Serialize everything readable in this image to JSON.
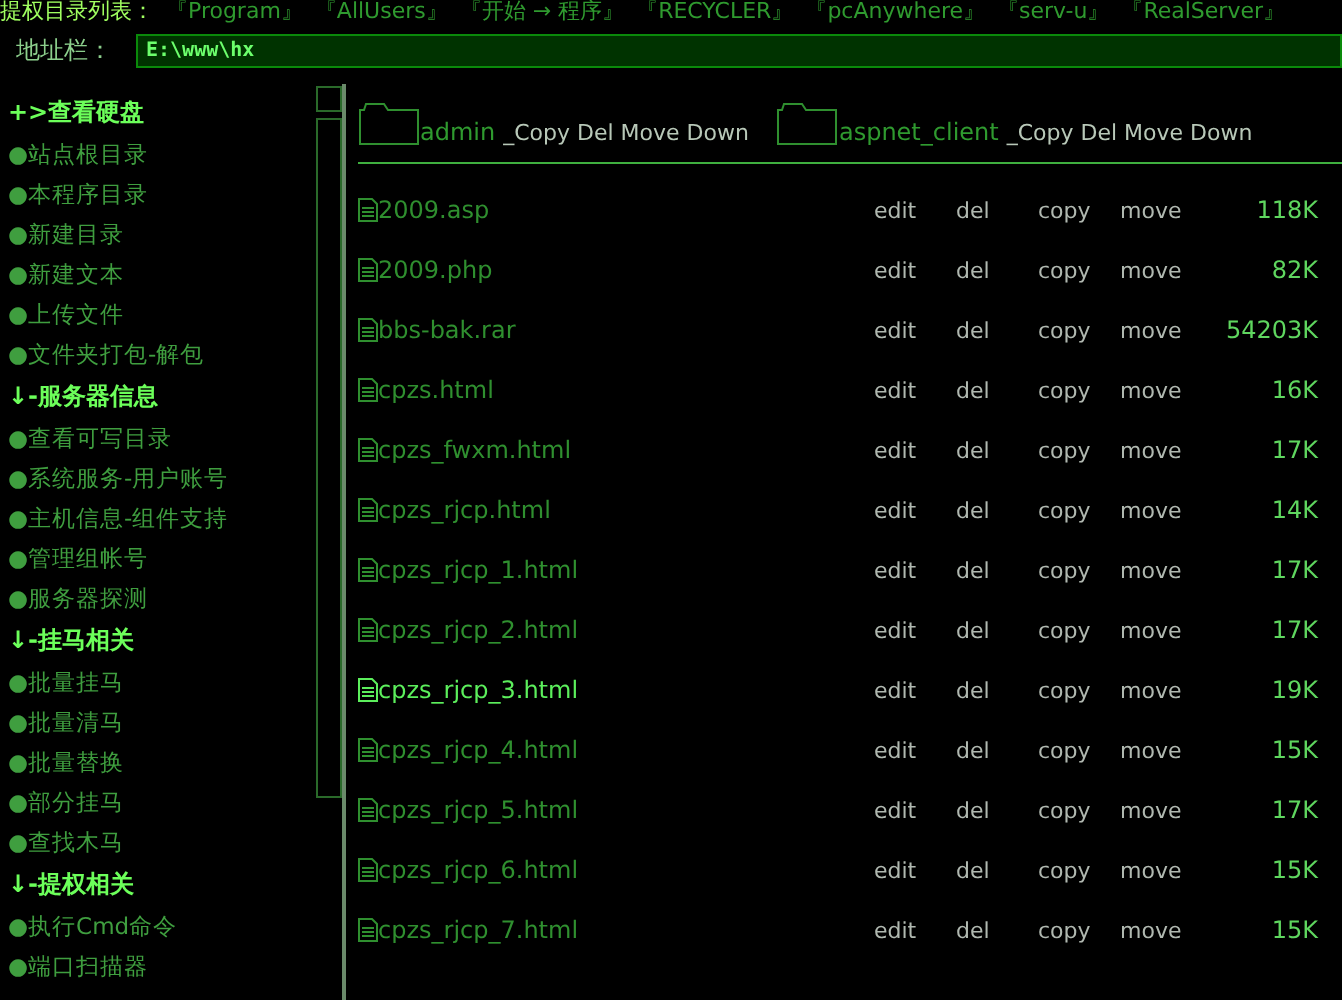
{
  "top_bar": {
    "label": "提权目录列表：",
    "links": [
      "『Program』",
      "『AllUsers』",
      "『开始 → 程序』",
      "『RECYCLER』",
      "『pcAnywhere』",
      "『serv-u』",
      "『RealServer』"
    ]
  },
  "address_bar": {
    "label": "地址栏：",
    "value": "E:\\www\\hx"
  },
  "sidebar": {
    "groups": [
      {
        "title": "+>查看硬盘",
        "items": [
          "●站点根目录",
          "●本程序目录",
          "●新建目录",
          "●新建文本",
          "●上传文件",
          "●文件夹打包-解包"
        ]
      },
      {
        "title": "↓-服务器信息",
        "items": [
          "●查看可写目录",
          "●系统服务-用户账号",
          "●主机信息-组件支持",
          "●管理组帐号",
          "●服务器探测"
        ]
      },
      {
        "title": "↓-挂马相关",
        "items": [
          "●批量挂马",
          "●批量清马",
          "●批量替换",
          "●部分挂马",
          "●查找木马"
        ]
      },
      {
        "title": "↓-提权相关",
        "items": [
          "●执行Cmd命令",
          "●端口扫描器"
        ]
      }
    ]
  },
  "folders": [
    {
      "name": "admin",
      "actions": "_Copy Del Move Down"
    },
    {
      "name": "aspnet_client",
      "actions": "_Copy Del Move Down"
    }
  ],
  "files": [
    {
      "name": "2009.asp",
      "actions": [
        "edit",
        "del",
        "copy",
        "move"
      ],
      "size": "118K",
      "selected": false
    },
    {
      "name": "2009.php",
      "actions": [
        "edit",
        "del",
        "copy",
        "move"
      ],
      "size": "82K",
      "selected": false
    },
    {
      "name": "bbs-bak.rar",
      "actions": [
        "edit",
        "del",
        "copy",
        "move"
      ],
      "size": "54203K",
      "selected": false
    },
    {
      "name": "cpzs.html",
      "actions": [
        "edit",
        "del",
        "copy",
        "move"
      ],
      "size": "16K",
      "selected": false
    },
    {
      "name": "cpzs_fwxm.html",
      "actions": [
        "edit",
        "del",
        "copy",
        "move"
      ],
      "size": "17K",
      "selected": false
    },
    {
      "name": "cpzs_rjcp.html",
      "actions": [
        "edit",
        "del",
        "copy",
        "move"
      ],
      "size": "14K",
      "selected": false
    },
    {
      "name": "cpzs_rjcp_1.html",
      "actions": [
        "edit",
        "del",
        "copy",
        "move"
      ],
      "size": "17K",
      "selected": false
    },
    {
      "name": "cpzs_rjcp_2.html",
      "actions": [
        "edit",
        "del",
        "copy",
        "move"
      ],
      "size": "17K",
      "selected": false
    },
    {
      "name": "cpzs_rjcp_3.html",
      "actions": [
        "edit",
        "del",
        "copy",
        "move"
      ],
      "size": "19K",
      "selected": true
    },
    {
      "name": "cpzs_rjcp_4.html",
      "actions": [
        "edit",
        "del",
        "copy",
        "move"
      ],
      "size": "15K",
      "selected": false
    },
    {
      "name": "cpzs_rjcp_5.html",
      "actions": [
        "edit",
        "del",
        "copy",
        "move"
      ],
      "size": "17K",
      "selected": false
    },
    {
      "name": "cpzs_rjcp_6.html",
      "actions": [
        "edit",
        "del",
        "copy",
        "move"
      ],
      "size": "15K",
      "selected": false
    },
    {
      "name": "cpzs_rjcp_7.html",
      "actions": [
        "edit",
        "del",
        "copy",
        "move"
      ],
      "size": "15K",
      "selected": false
    }
  ]
}
